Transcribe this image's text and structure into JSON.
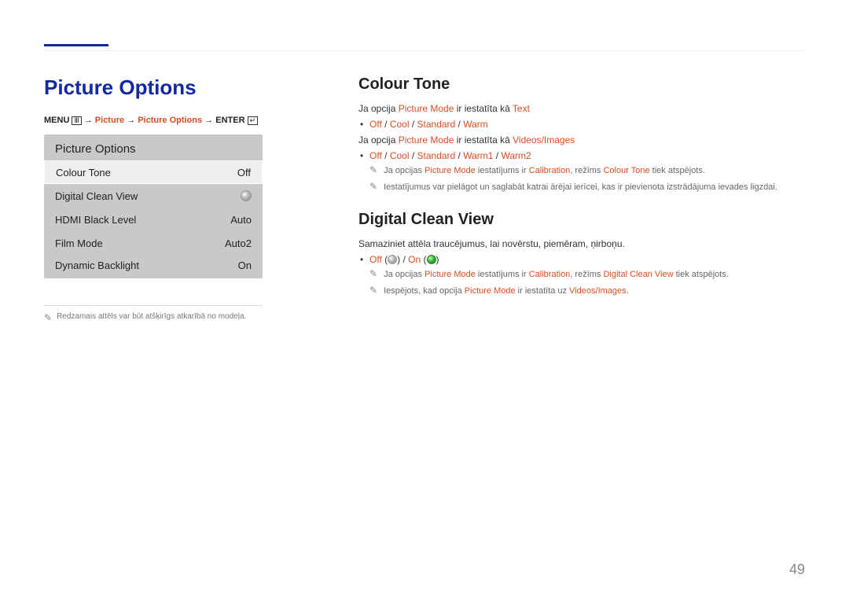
{
  "page_number": "49",
  "section_title": "Picture Options",
  "breadcrumb": {
    "menu": "MENU",
    "picture": "Picture",
    "picture_options": "Picture Options",
    "enter": "ENTER"
  },
  "panel": {
    "title": "Picture Options",
    "rows": [
      {
        "label": "Colour Tone",
        "value": "Off",
        "selected": true
      },
      {
        "label": "Digital Clean View",
        "value": "",
        "radio": true
      },
      {
        "label": "HDMI Black Level",
        "value": "Auto"
      },
      {
        "label": "Film Mode",
        "value": "Auto2"
      },
      {
        "label": "Dynamic Backlight",
        "value": "On"
      }
    ]
  },
  "footnote": "Redzamais attēls var būt atšķirīgs atkarībā no modeļa.",
  "colour_tone": {
    "heading": "Colour Tone",
    "line1_pre": "Ja opcija ",
    "line1_hl": "Picture Mode",
    "line1_mid": " ir iestatīta kā ",
    "line1_hl2": "Text",
    "opts1": {
      "off": "Off",
      "cool": "Cool",
      "standard": "Standard",
      "warm": "Warm"
    },
    "line2_pre": "Ja opcija ",
    "line2_hl": "Picture Mode",
    "line2_mid": " ir iestatīta kā ",
    "line2_hl2": "Videos/Images",
    "opts2": {
      "off": "Off",
      "cool": "Cool",
      "standard": "Standard",
      "warm1": "Warm1",
      "warm2": "Warm2"
    },
    "note1_pre": "Ja opcijas ",
    "note1_hl1": "Picture Mode",
    "note1_mid": " iestatījums ir ",
    "note1_hl2": "Calibration",
    "note1_mid2": ", režīms ",
    "note1_hl3": "Colour Tone",
    "note1_post": " tiek atspējots.",
    "note2": "Iestatījumus var pielāgot un saglabāt katrai ārējai ierīcei, kas ir pievienota izstrādājuma ievades ligzdai."
  },
  "dcv": {
    "heading": "Digital Clean View",
    "desc": "Samaziniet attēla traucējumus, lai novērstu, piemēram, ņirboņu.",
    "off": "Off",
    "on": "On",
    "note1_pre": "Ja opcijas ",
    "note1_hl1": "Picture Mode",
    "note1_mid": " iestatījums ir ",
    "note1_hl2": "Calibration",
    "note1_mid2": ", režīms ",
    "note1_hl3": "Digital Clean View",
    "note1_post": " tiek atspējots.",
    "note2_pre": "Iespējots, kad opcija ",
    "note2_hl1": "Picture Mode",
    "note2_mid": " ir iestatīta uz ",
    "note2_hl2": "Videos/Images",
    "note2_post": "."
  }
}
